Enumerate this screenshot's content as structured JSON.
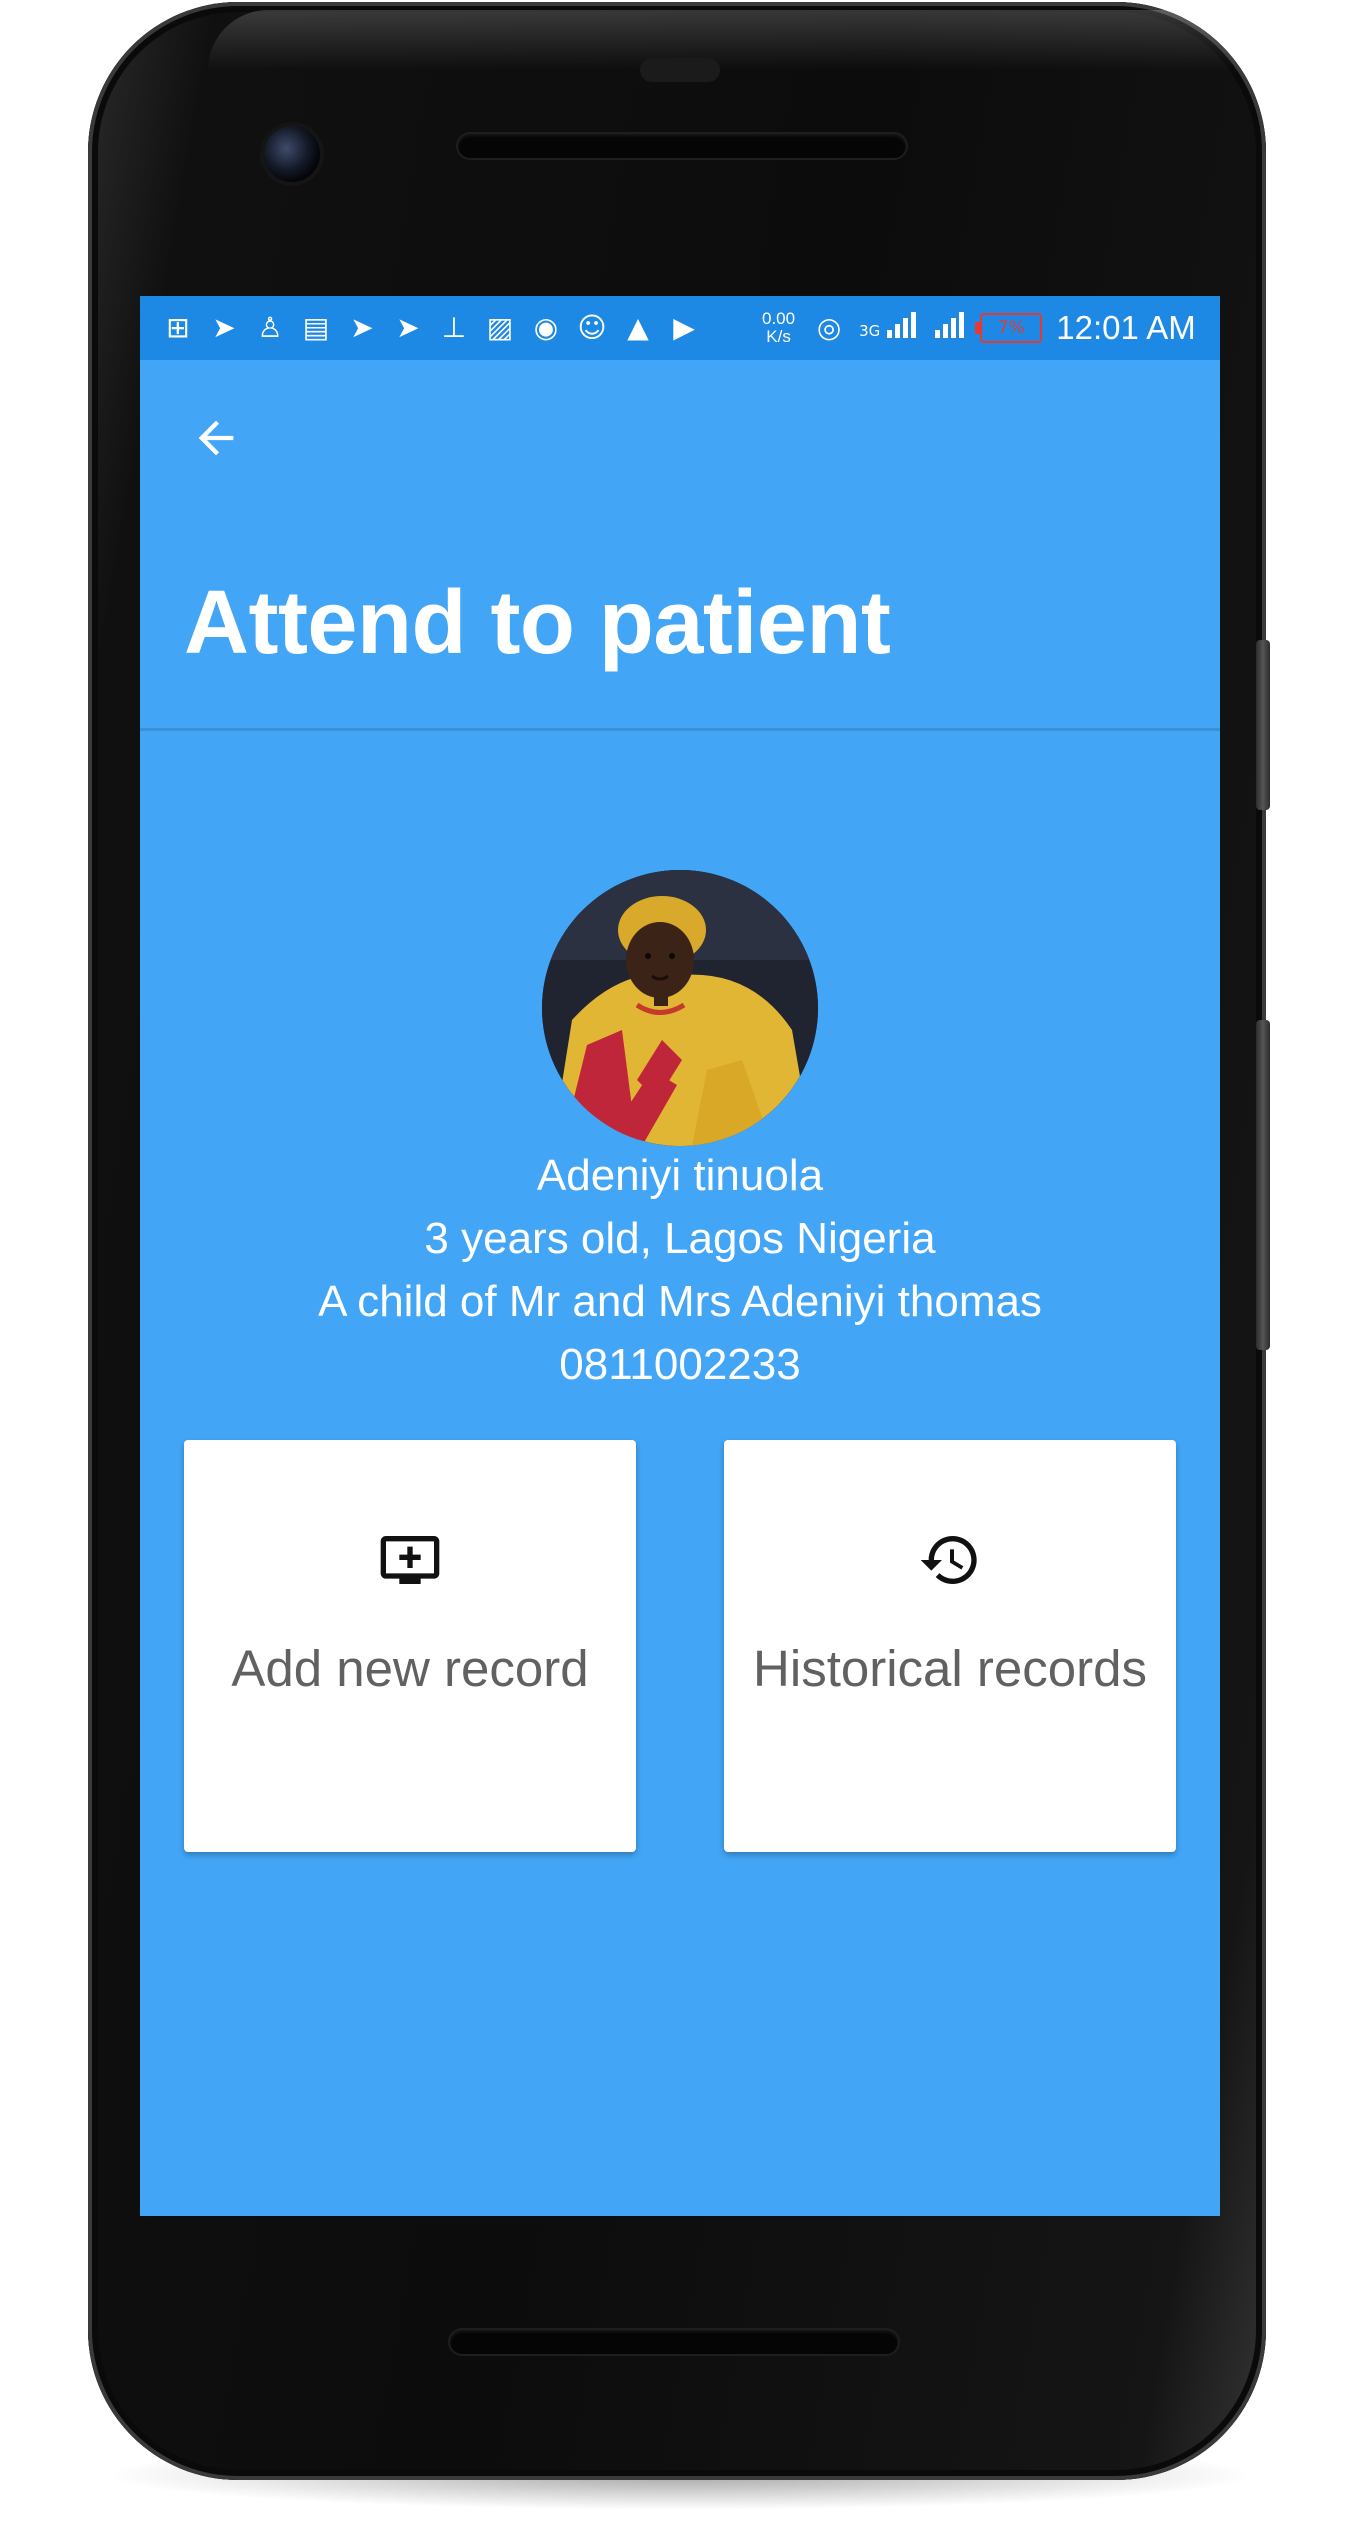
{
  "status_bar": {
    "notification_icons": [
      "add-box-icon",
      "telegram-icon",
      "shirt-icon",
      "message-icon",
      "telegram-icon",
      "telegram-icon",
      "cleaner-icon",
      "image-icon",
      "broadcast-icon",
      "smiley-icon",
      "warning-icon",
      "youtube-icon"
    ],
    "net_speed_value": "0.00",
    "net_speed_unit": "K/s",
    "network_type": "3G",
    "battery": "7%",
    "time": "12:01 AM"
  },
  "app_bar": {
    "back_icon": "arrow-back-icon",
    "title": "Attend to patient"
  },
  "patient": {
    "name": "Adeniyi tinuola",
    "age_location": "3 years old, Lagos Nigeria",
    "parents": "A child of Mr and Mrs Adeniyi thomas",
    "phone": "0811002233"
  },
  "actions": {
    "add_record": {
      "icon": "add-to-queue-icon",
      "label": "Add new record"
    },
    "historical": {
      "icon": "history-icon",
      "label": "Historical records"
    }
  },
  "colors": {
    "screen_background": "#42a5f5",
    "status_bar": "#1e88e5",
    "card_background": "#ffffff",
    "card_text": "#616161",
    "battery_low": "#e53935"
  }
}
